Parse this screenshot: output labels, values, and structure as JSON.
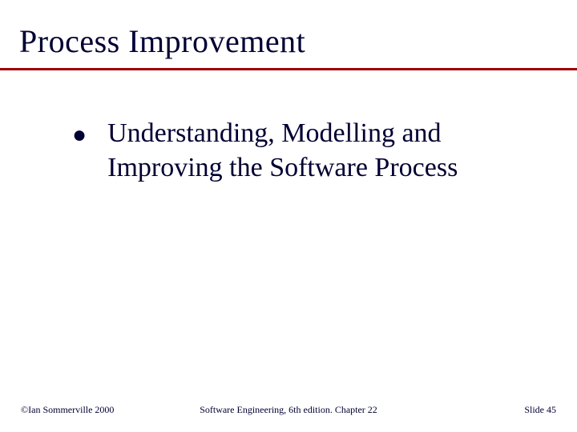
{
  "title": "Process Improvement",
  "bullets": [
    {
      "text": "Understanding, Modelling and Improving the Software Process"
    }
  ],
  "footer": {
    "left": "©Ian Sommerville 2000",
    "center": "Software Engineering, 6th edition. Chapter 22",
    "right": "Slide 45"
  },
  "colors": {
    "rule": "#990000",
    "text": "#000033"
  }
}
